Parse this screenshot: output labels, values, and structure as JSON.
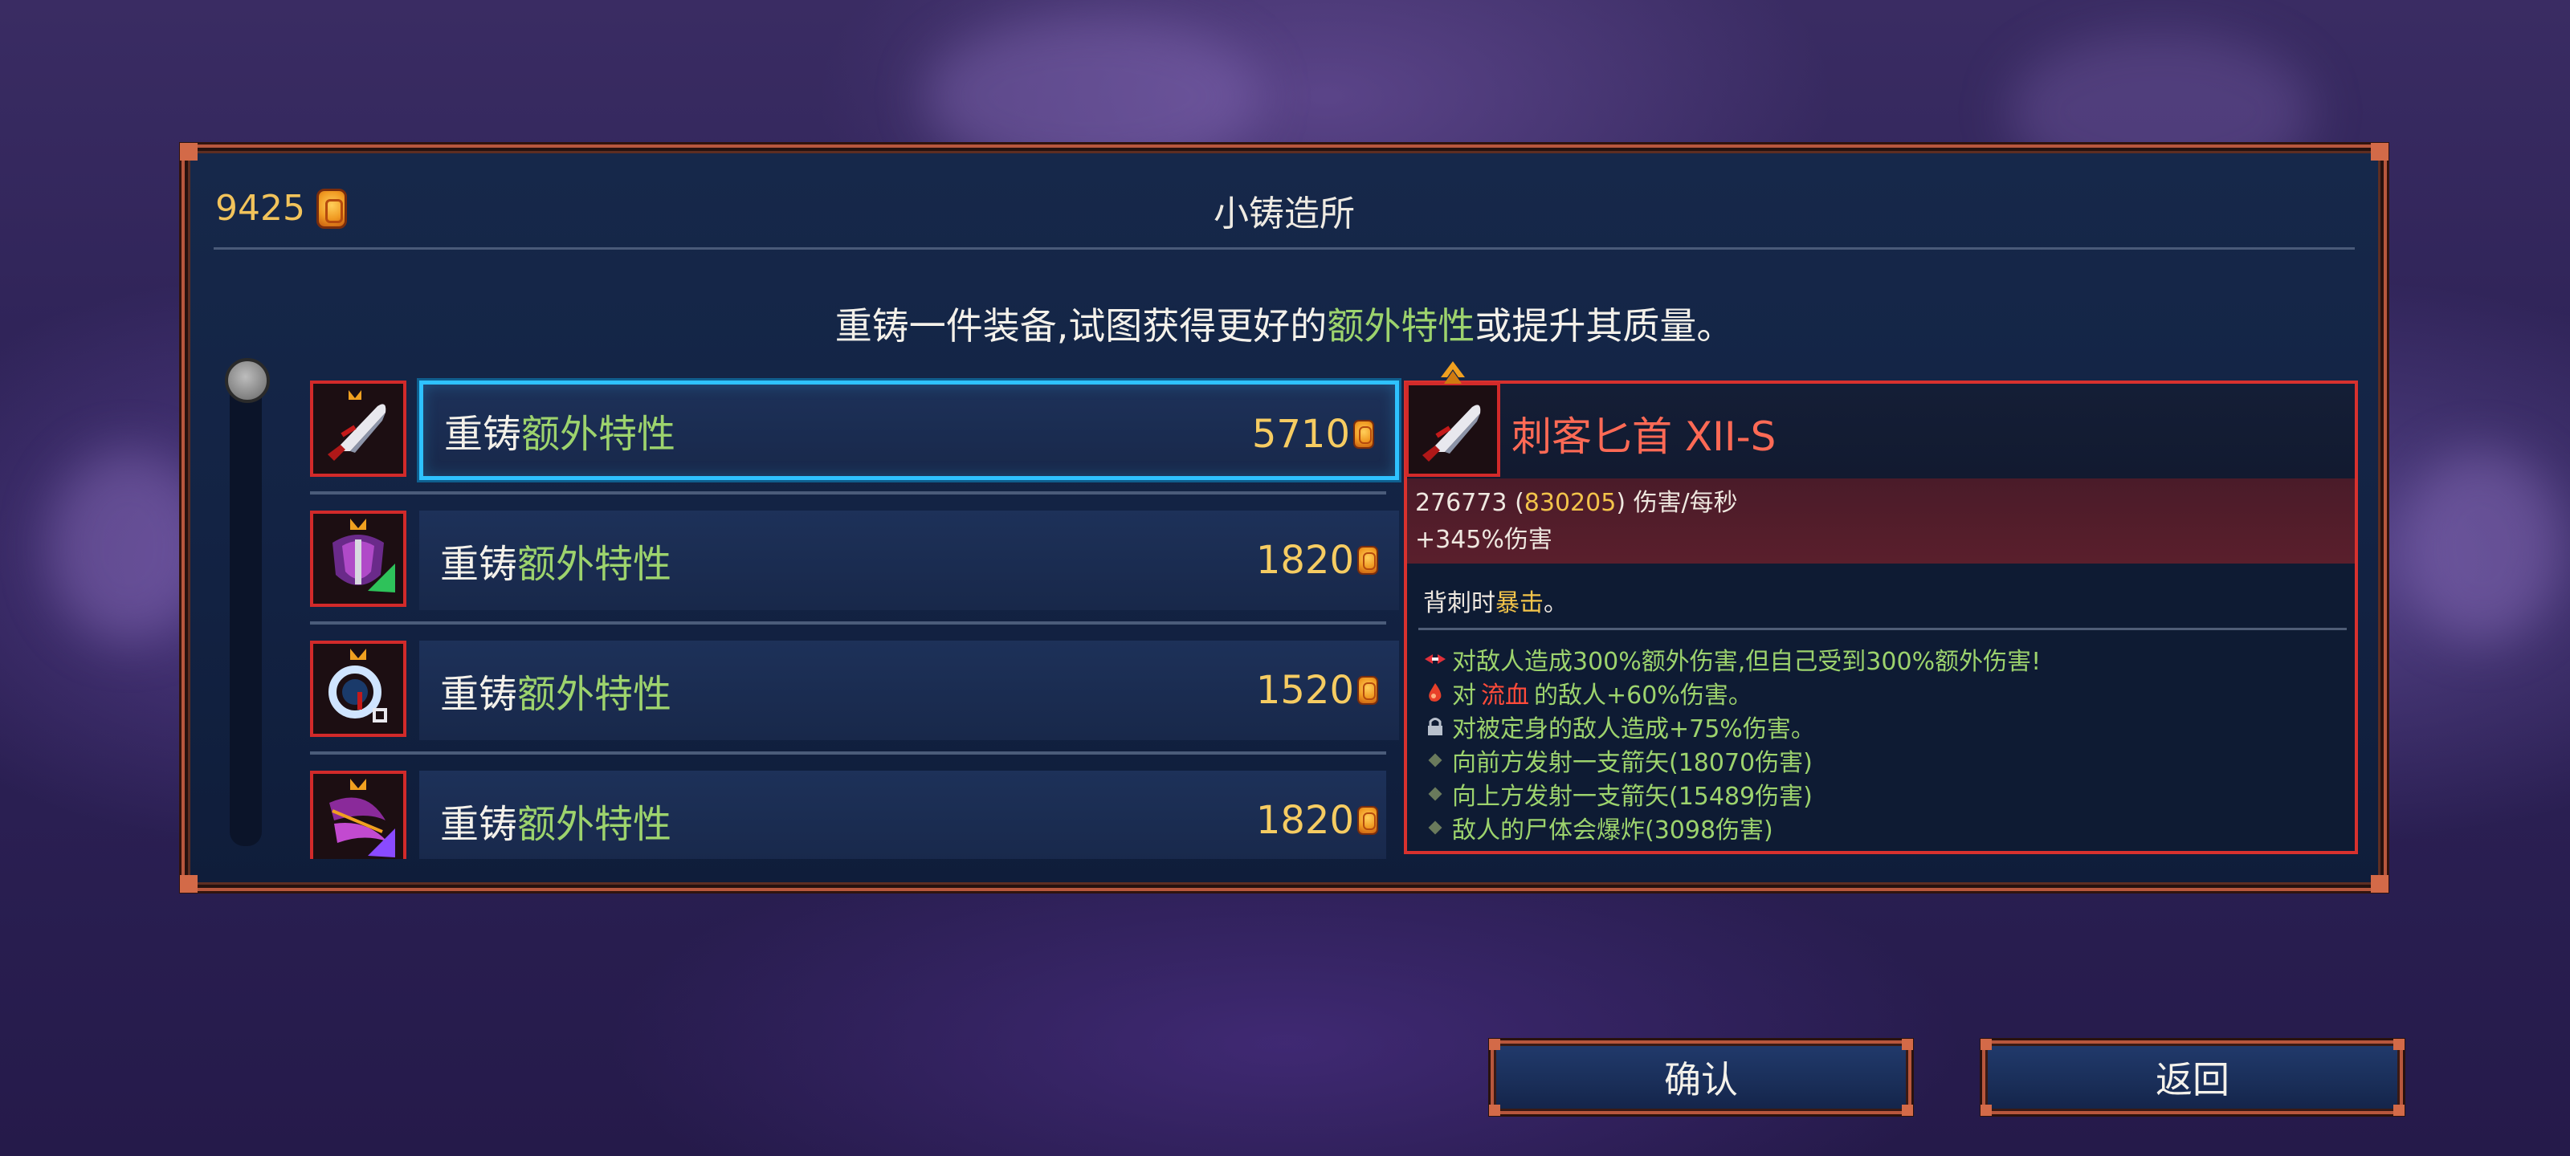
{
  "header": {
    "gold": "9425",
    "title": "小铸造所",
    "subtitle_pre": "重铸一件装备,试图获得更好的",
    "subtitle_hl": "额外特性",
    "subtitle_post": "或提升其质量。"
  },
  "list": {
    "rows": [
      {
        "label_pre": "重铸",
        "label_hl": "额外特性",
        "price": "5710",
        "icon": "dagger-icon",
        "selected": true
      },
      {
        "label_pre": "重铸",
        "label_hl": "额外特性",
        "price": "1820",
        "icon": "purple-shield-icon",
        "selected": false
      },
      {
        "label_pre": "重铸",
        "label_hl": "额外特性",
        "price": "1520",
        "icon": "amulet-icon",
        "selected": false
      },
      {
        "label_pre": "重铸",
        "label_hl": "额外特性",
        "price": "1820",
        "icon": "purple-bow-icon",
        "selected": false
      }
    ]
  },
  "detail": {
    "name": "刺客匕首 XII-S",
    "dps": "276773",
    "dps_crit": "830205",
    "dps_unit": "伤害/每秒",
    "bonus": "+345%伤害",
    "passive_pre": "背刺时",
    "passive_hl": "暴击",
    "passive_post": "。",
    "affixes": [
      {
        "icon": "double-edge-icon",
        "text": "对敌人造成300%额外伤害,但自己受到300%额外伤害!"
      },
      {
        "icon": "blood-drop-icon",
        "pre": "对",
        "hl": "流血",
        "post": "的敌人+60%伤害。"
      },
      {
        "icon": "lock-icon",
        "text": "对被定身的敌人造成+75%伤害。"
      },
      {
        "icon": "diamond-icon",
        "text": "向前方发射一支箭矢(18070伤害)"
      },
      {
        "icon": "diamond-icon",
        "text": "向上方发射一支箭矢(15489伤害)"
      },
      {
        "icon": "diamond-icon",
        "text": "敌人的尸体会爆炸(3098伤害)"
      }
    ]
  },
  "buttons": {
    "confirm": "确认",
    "back": "返回"
  },
  "colors": {
    "gold": "#f2c35b",
    "highlight_green": "#9dd36d",
    "highlight_red": "#ff4b3a",
    "selected_border": "#2ec2ff",
    "frame": "#b8573d"
  }
}
